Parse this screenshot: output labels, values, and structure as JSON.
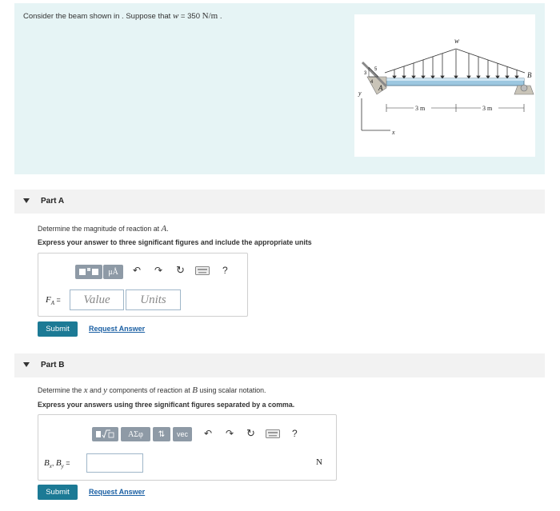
{
  "problem": {
    "text_before": "Consider the beam shown in . Suppose that ",
    "var": "w",
    "equals": " = 350 ",
    "unit": "N/m",
    "text_after": " ."
  },
  "figure": {
    "load_label": "w",
    "support_a": "A",
    "support_b": "B",
    "slope_3": "3",
    "slope_4": "4",
    "slope_5": "5",
    "axis_y": "y",
    "axis_x": "x",
    "dim_left": "3 m",
    "dim_right": "3 m"
  },
  "part_a": {
    "title": "Part A",
    "instruction_prefix": "Determine the magnitude of reaction at ",
    "instruction_var": "A",
    "instruction_suffix": ".",
    "bold_instruction": "Express your answer to three significant figures and include the appropriate units",
    "label": "F",
    "label_sub": "A",
    "equals": " =",
    "value_placeholder": "Value",
    "units_placeholder": "Units",
    "tool_mu": "μÅ",
    "tool_help": "?",
    "submit": "Submit",
    "request": "Request Answer"
  },
  "part_b": {
    "title": "Part B",
    "instruction_1": "Determine the ",
    "var_x": "x",
    "instruction_2": " and ",
    "var_y": "y",
    "instruction_3": " components of reaction at ",
    "var_b": "B",
    "instruction_4": " using scalar notation.",
    "bold_instruction": "Express your answers using three significant figures separated by a comma.",
    "label": "B",
    "sub_x": "x",
    "sep": ", ",
    "label2": "B",
    "sub_y": "y",
    "equals": " =",
    "unit": "N",
    "tool_sym": "ΑΣφ",
    "tool_vec": "vec",
    "tool_help": "?",
    "submit": "Submit",
    "request": "Request Answer"
  }
}
